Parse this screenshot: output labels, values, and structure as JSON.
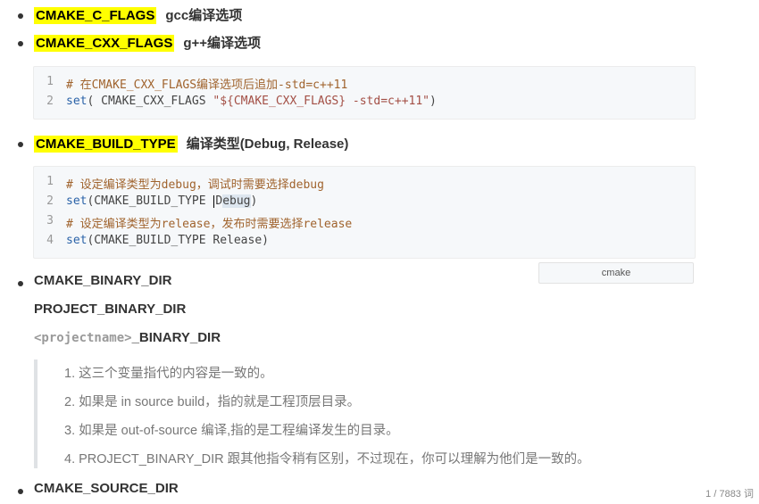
{
  "bullets": {
    "b1": {
      "keyword": "CMAKE_C_FLAGS",
      "desc": "gcc编译选项"
    },
    "b2": {
      "keyword": "CMAKE_CXX_FLAGS",
      "desc": "g++编译选项"
    },
    "b3": {
      "keyword": "CMAKE_BUILD_TYPE",
      "desc": "编译类型(Debug, Release)"
    },
    "b4": {
      "line1": "CMAKE_BINARY_DIR",
      "line2": "PROJECT_BINARY_DIR",
      "line3_code": "<projectname>",
      "line3_rest": "_BINARY_DIR"
    },
    "b5": {
      "keyword": "CMAKE_SOURCE_DIR"
    }
  },
  "code1": {
    "line_numbers": [
      "1",
      "2"
    ],
    "l1_comment": "# 在CMAKE_CXX_FLAGS编译选项后追加-std=c++11",
    "l2_fn": "set",
    "l2_a": "( CMAKE_CXX_FLAGS ",
    "l2_str": "\"${CMAKE_CXX_FLAGS} -std=c++11\"",
    "l2_b": ")"
  },
  "code2": {
    "line_numbers": [
      "1",
      "2",
      "3",
      "4"
    ],
    "l1_comment": "# 设定编译类型为debug，调试时需要选择debug",
    "l2_fn": "set",
    "l2_a": "(CMAKE_BUILD_TYPE ",
    "l2_d": "D",
    "l2_sel": "ebug",
    "l2_b": ")",
    "l3_comment": "# 设定编译类型为release，发布时需要选择release",
    "l4_fn": "set",
    "l4_a": "(CMAKE_BUILD_TYPE Release)",
    "language": "cmake"
  },
  "quote_items": [
    "1. 这三个变量指代的内容是一致的。",
    "2. 如果是 in source build，指的就是工程顶层目录。",
    "3. 如果是 out-of-source 编译,指的是工程编译发生的目录。",
    "4. PROJECT_BINARY_DIR 跟其他指令稍有区别，不过现在，你可以理解为他们是一致的。"
  ],
  "status": {
    "word_count": "1 / 7883 词"
  }
}
